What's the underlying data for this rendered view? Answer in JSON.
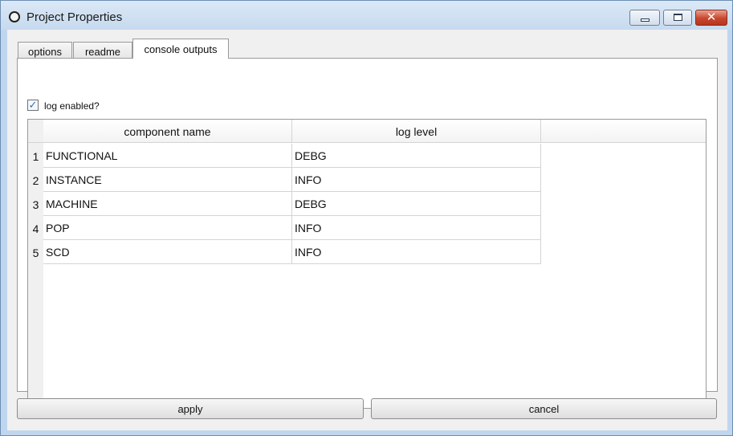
{
  "window": {
    "title": "Project Properties",
    "icon": "circle-icon",
    "controls": {
      "minimize": "minimize-icon",
      "maximize": "maximize-icon",
      "close": "✕"
    }
  },
  "tabs": [
    {
      "label": "options",
      "selected": false
    },
    {
      "label": "readme",
      "selected": false
    },
    {
      "label": "console outputs",
      "selected": true
    }
  ],
  "log": {
    "checkbox_label": "log enabled?",
    "checked": true,
    "check_glyph": "✓"
  },
  "table": {
    "columns": [
      "component name",
      "log level"
    ],
    "rows": [
      {
        "num": "1",
        "name": "FUNCTIONAL",
        "level": "DEBG"
      },
      {
        "num": "2",
        "name": "INSTANCE",
        "level": "INFO"
      },
      {
        "num": "3",
        "name": "MACHINE",
        "level": "DEBG"
      },
      {
        "num": "4",
        "name": "POP",
        "level": "INFO"
      },
      {
        "num": "5",
        "name": "SCD",
        "level": "INFO"
      }
    ]
  },
  "buttons": {
    "apply": "apply",
    "cancel": "cancel"
  },
  "colors": {
    "titlebar": "#c6daef",
    "close_button": "#c7472e",
    "checkmark": "#3d6fb4"
  }
}
